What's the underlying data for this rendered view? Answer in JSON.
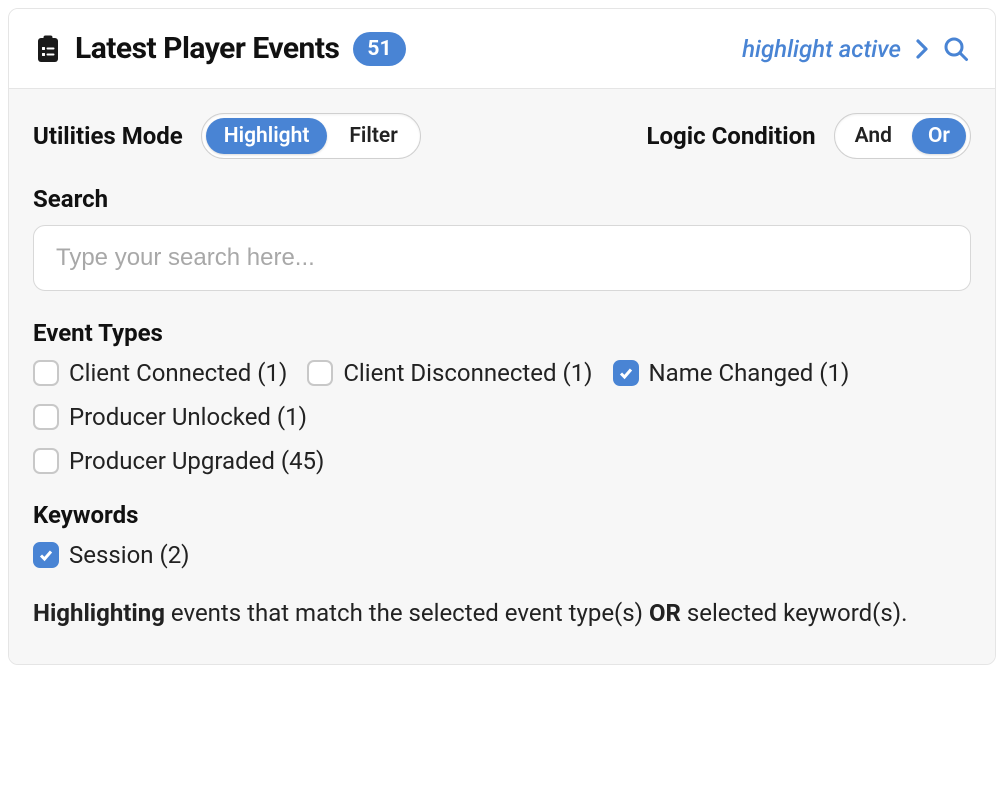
{
  "header": {
    "title": "Latest Player Events",
    "count_badge": "51",
    "status_text": "highlight active"
  },
  "controls": {
    "utilities_mode": {
      "label": "Utilities Mode",
      "options": [
        "Highlight",
        "Filter"
      ],
      "active": "Highlight"
    },
    "logic_condition": {
      "label": "Logic Condition",
      "options": [
        "And",
        "Or"
      ],
      "active": "Or"
    }
  },
  "search": {
    "label": "Search",
    "placeholder": "Type your search here...",
    "value": ""
  },
  "event_types": {
    "label": "Event Types",
    "items": [
      {
        "label": "Client Connected (1)",
        "checked": false
      },
      {
        "label": "Client Disconnected (1)",
        "checked": false
      },
      {
        "label": "Name Changed (1)",
        "checked": true
      },
      {
        "label": "Producer Unlocked (1)",
        "checked": false
      },
      {
        "label": "Producer Upgraded (45)",
        "checked": false
      }
    ]
  },
  "keywords": {
    "label": "Keywords",
    "items": [
      {
        "label": "Session (2)",
        "checked": true
      }
    ]
  },
  "summary": {
    "prefix_bold": "Highlighting",
    "mid": " events that match the selected event type(s) ",
    "or_bold": "OR",
    "suffix": " selected keyword(s)."
  }
}
